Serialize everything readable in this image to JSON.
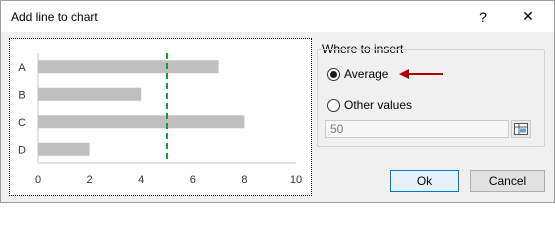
{
  "dialog": {
    "title": "Add line to chart",
    "help_symbol": "?",
    "close_symbol": "✕"
  },
  "insert_options": {
    "group_label": "Where to insert",
    "average_label": "Average",
    "average_selected": true,
    "other_values_label": "Other values",
    "other_values_selected": false,
    "value": "50"
  },
  "buttons": {
    "ok": "Ok",
    "cancel": "Cancel"
  },
  "colors": {
    "bar": "#bfbfbf",
    "average_line": "#1a9b3c",
    "annotation_arrow": "#b00000",
    "ok_border": "#0078d7"
  },
  "chart_data": {
    "type": "bar",
    "orientation": "horizontal",
    "categories": [
      "A",
      "B",
      "C",
      "D"
    ],
    "values": [
      7,
      4,
      8,
      2
    ],
    "x_ticks": [
      "0",
      "2",
      "4",
      "6",
      "8",
      "10"
    ],
    "xlim": [
      0,
      10
    ],
    "average_line": 5,
    "grid": false
  }
}
